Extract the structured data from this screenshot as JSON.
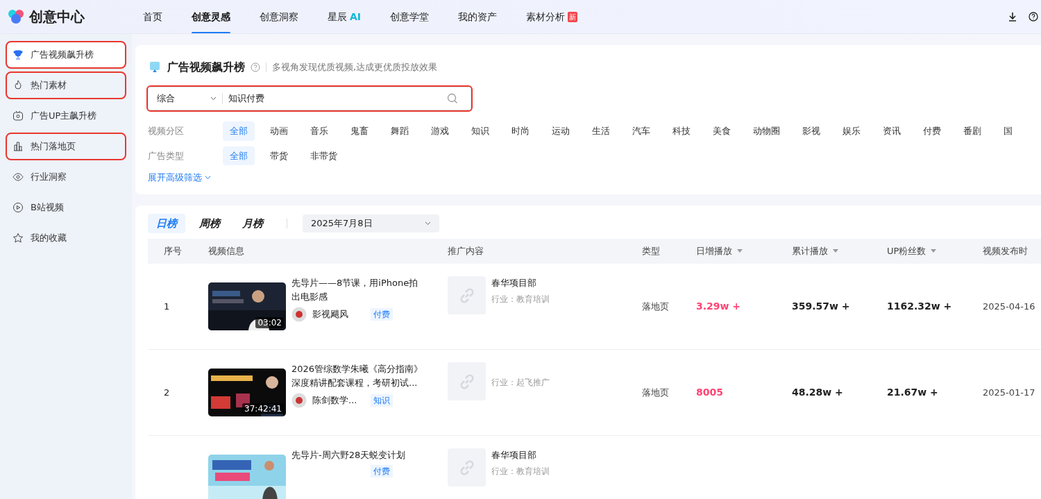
{
  "brand": "创意中心",
  "nav": [
    {
      "label": "首页",
      "selected": false
    },
    {
      "label": "创意灵感",
      "selected": true
    },
    {
      "label": "创意洞察",
      "selected": false
    },
    {
      "label": "星辰",
      "suffix": "AI",
      "selected": false
    },
    {
      "label": "创意学堂",
      "selected": false
    },
    {
      "label": "我的资产",
      "selected": false
    },
    {
      "label": "素材分析",
      "badge": "新",
      "selected": false
    }
  ],
  "sidebar": {
    "items": [
      {
        "label": "广告视频飙升榜",
        "selected": true,
        "highlighted": true
      },
      {
        "label": "热门素材",
        "selected": false,
        "highlighted": true
      },
      {
        "label": "广告UP主飙升榜",
        "selected": false,
        "highlighted": false
      },
      {
        "label": "热门落地页",
        "selected": false,
        "highlighted": true
      },
      {
        "label": "行业洞察",
        "selected": false,
        "highlighted": false
      },
      {
        "label": "B站视频",
        "selected": false,
        "highlighted": false
      },
      {
        "label": "我的收藏",
        "selected": false,
        "highlighted": false
      }
    ]
  },
  "page": {
    "title": "广告视频飙升榜",
    "subtitle": "多视角发现优质视频,达成更优质投放效果"
  },
  "search": {
    "scope": "综合",
    "value": "知识付费",
    "highlighted": true
  },
  "filters": [
    {
      "label": "视频分区",
      "options": [
        {
          "label": "全部",
          "selected": true
        },
        {
          "label": "动画",
          "selected": false
        },
        {
          "label": "音乐",
          "selected": false
        },
        {
          "label": "鬼畜",
          "selected": false
        },
        {
          "label": "舞蹈",
          "selected": false
        },
        {
          "label": "游戏",
          "selected": false
        },
        {
          "label": "知识",
          "selected": false
        },
        {
          "label": "时尚",
          "selected": false
        },
        {
          "label": "运动",
          "selected": false
        },
        {
          "label": "生活",
          "selected": false
        },
        {
          "label": "汽车",
          "selected": false
        },
        {
          "label": "科技",
          "selected": false
        },
        {
          "label": "美食",
          "selected": false
        },
        {
          "label": "动物圈",
          "selected": false
        },
        {
          "label": "影视",
          "selected": false
        },
        {
          "label": "娱乐",
          "selected": false
        },
        {
          "label": "资讯",
          "selected": false
        },
        {
          "label": "付费",
          "selected": false
        },
        {
          "label": "番剧",
          "selected": false
        },
        {
          "label": "国",
          "selected": false
        }
      ]
    },
    {
      "label": "广告类型",
      "options": [
        {
          "label": "全部",
          "selected": true
        },
        {
          "label": "带货",
          "selected": false
        },
        {
          "label": "非带货",
          "selected": false
        }
      ]
    }
  ],
  "expand_filters": "展开高级筛选",
  "period_tabs": [
    {
      "label": "日榜",
      "selected": true
    },
    {
      "label": "周榜",
      "selected": false
    },
    {
      "label": "月榜",
      "selected": false
    }
  ],
  "date": "2025年7月8日",
  "table": {
    "columns": [
      {
        "label": "序号",
        "sortable": false
      },
      {
        "label": "视频信息",
        "sortable": false
      },
      {
        "label": "推广内容",
        "sortable": false
      },
      {
        "label": "类型",
        "sortable": false
      },
      {
        "label": "日增播放",
        "sortable": true
      },
      {
        "label": "累计播放",
        "sortable": true
      },
      {
        "label": "UP粉丝数",
        "sortable": true
      },
      {
        "label": "视频发布时",
        "sortable": false
      }
    ],
    "rows": [
      {
        "rank": "1",
        "title": "先导片——8节课，用iPhone拍出电影感",
        "duration": "03:02",
        "author": "影视飓风",
        "tag": "付费",
        "promo_name": "春华项目部",
        "industry": "行业：教育培训",
        "type": "落地页",
        "daily": "3.29w +",
        "total": "359.57w +",
        "fans": "1162.32w +",
        "date": "2025-04-16"
      },
      {
        "rank": "2",
        "title": "2026管综数学朱曦《高分指南》深度精讲配套课程，考研初试...",
        "duration": "37:42:41",
        "author": "陈剑数学...",
        "tag": "知识",
        "industry": "行业：起飞推广",
        "type": "落地页",
        "daily": "8005",
        "total": "48.28w +",
        "fans": "21.67w +",
        "date": "2025-01-17"
      },
      {
        "title": "先导片-周六野28天蜕变计划",
        "tag": "付费",
        "promo_name": "春华项目部",
        "industry": "行业：教育培训"
      }
    ]
  }
}
